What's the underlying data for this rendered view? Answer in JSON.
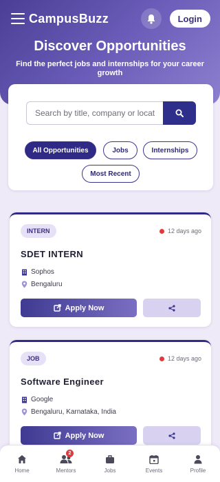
{
  "header": {
    "brand": "CampusBuzz",
    "login_label": "Login",
    "hero_title": "Discover Opportunities",
    "hero_subtitle": "Find the perfect jobs and internships for your career growth"
  },
  "search": {
    "placeholder": "Search by title, company or location"
  },
  "filters": [
    {
      "label": "All Opportunities",
      "active": true
    },
    {
      "label": "Jobs",
      "active": false
    },
    {
      "label": "Internships",
      "active": false
    },
    {
      "label": "Most Recent",
      "active": false
    }
  ],
  "jobs": [
    {
      "type": "INTERN",
      "posted": "12 days ago",
      "title": "SDET INTERN",
      "company": "Sophos",
      "location": "Bengaluru",
      "apply_label": "Apply Now"
    },
    {
      "type": "JOB",
      "posted": "12 days ago",
      "title": "Software Engineer",
      "company": "Google",
      "location": "Bengaluru, Karnataka, India",
      "apply_label": "Apply Now"
    }
  ],
  "nav": [
    {
      "label": "Home",
      "icon": "home-icon"
    },
    {
      "label": "Mentors",
      "icon": "users-icon",
      "badge": "2"
    },
    {
      "label": "Jobs",
      "icon": "briefcase-icon"
    },
    {
      "label": "Events",
      "icon": "calendar-icon"
    },
    {
      "label": "Profile",
      "icon": "user-icon"
    }
  ],
  "colors": {
    "primary": "#2f2a86",
    "accent": "#7a6fc2",
    "alert": "#e0393e",
    "background": "#efeaf7"
  }
}
